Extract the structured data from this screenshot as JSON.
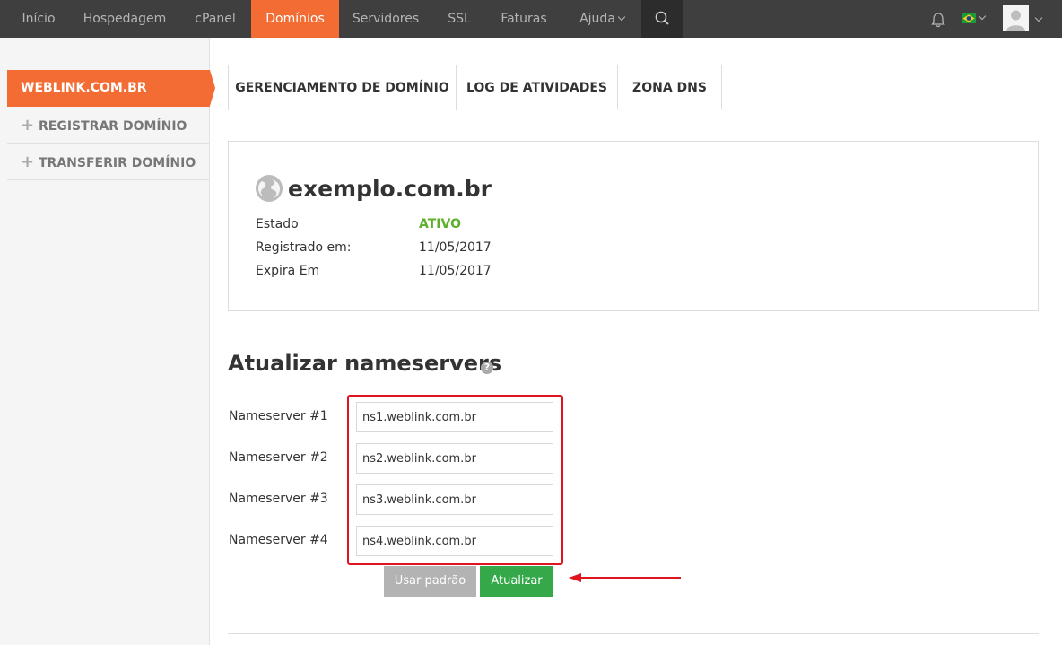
{
  "nav": {
    "items": [
      {
        "label": "Início"
      },
      {
        "label": "Hospedagem"
      },
      {
        "label": "cPanel"
      },
      {
        "label": "Domínios",
        "active": true
      },
      {
        "label": "Servidores"
      },
      {
        "label": "SSL"
      },
      {
        "label": "Faturas"
      },
      {
        "label": "Ajuda"
      }
    ],
    "icons": [
      "search-icon",
      "bell-icon",
      "brazil-flag-icon",
      "avatar-icon"
    ]
  },
  "sidebar": {
    "items": [
      {
        "label": "WEBLINK.COM.BR",
        "active": true
      },
      {
        "label": "REGISTRAR DOMÍNIO"
      },
      {
        "label": "TRANSFERIR DOMÍNIO"
      }
    ]
  },
  "tabs": [
    {
      "label": "GERENCIAMENTO DE DOMÍNIO",
      "active": true
    },
    {
      "label": "LOG DE ATIVIDADES"
    },
    {
      "label": "ZONA DNS"
    }
  ],
  "domain": {
    "name": "exemplo.com.br",
    "fields": [
      {
        "label": "Estado",
        "value": "ATIVO"
      },
      {
        "label": "Registrado em:",
        "value": "11/05/2017"
      },
      {
        "label": "Expira Em",
        "value": "11/05/2017"
      }
    ]
  },
  "nameservers": {
    "title": "Atualizar nameservers",
    "help_icon": "?",
    "rows": [
      {
        "label": "Nameserver #1",
        "value": "ns1.weblink.com.br"
      },
      {
        "label": "Nameserver #2",
        "value": "ns2.weblink.com.br"
      },
      {
        "label": "Nameserver #3",
        "value": "ns3.weblink.com.br"
      },
      {
        "label": "Nameserver #4",
        "value": "ns4.weblink.com.br"
      }
    ],
    "default_button": "Usar padrão",
    "submit_button": "Atualizar"
  },
  "colors": {
    "accent": "#f26c33",
    "nav_bg": "#3f3f3f",
    "success": "#35a84a",
    "status_active": "#5cb02a",
    "highlight": "#e0141e"
  }
}
